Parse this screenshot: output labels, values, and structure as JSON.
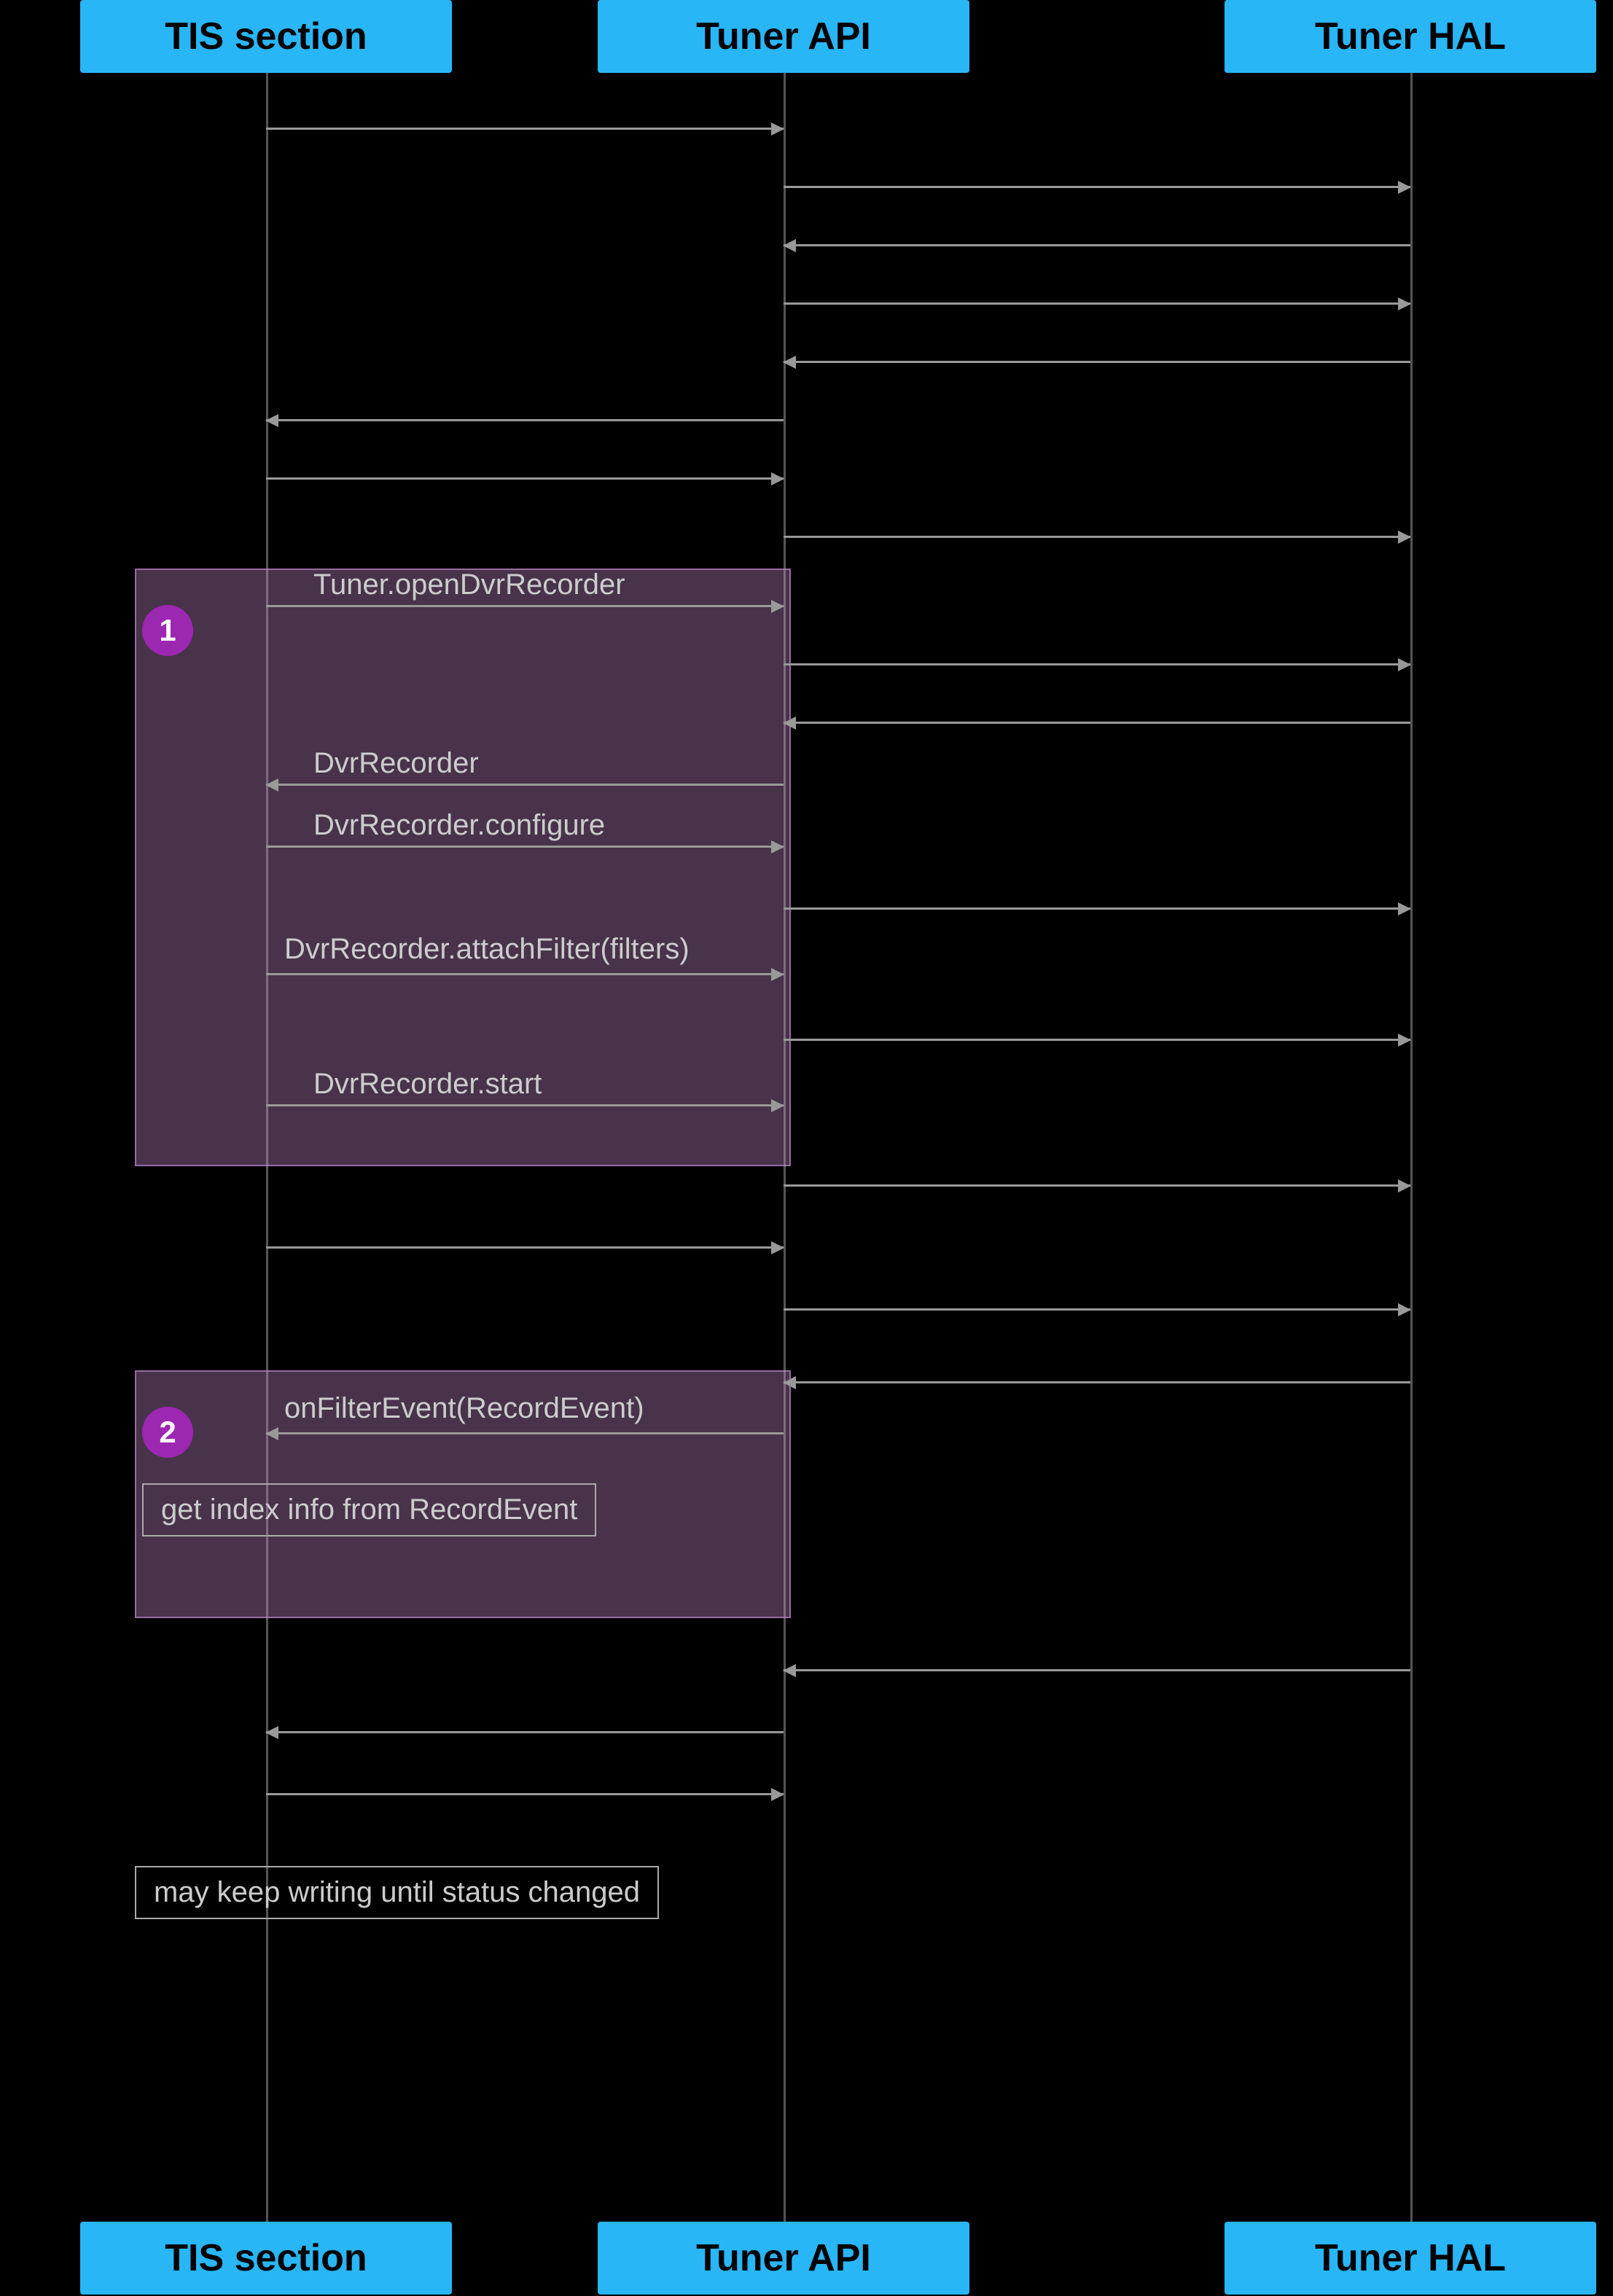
{
  "headers": {
    "tis": "TIS section",
    "tuner_api": "Tuner API",
    "tuner_hal": "Tuner HAL"
  },
  "steps": {
    "step1": "1",
    "step2": "2"
  },
  "labels": {
    "openDvrRecorder": "Tuner.openDvrRecorder",
    "dvrRecorder": "DvrRecorder",
    "configure": "DvrRecorder.configure",
    "attachFilter": "DvrRecorder.attachFilter(filters)",
    "start": "DvrRecorder.start",
    "onFilterEvent": "onFilterEvent(RecordEvent)",
    "getIndexInfo": "get index info from RecordEvent",
    "mayKeepWriting": "may keep writing until status changed"
  }
}
